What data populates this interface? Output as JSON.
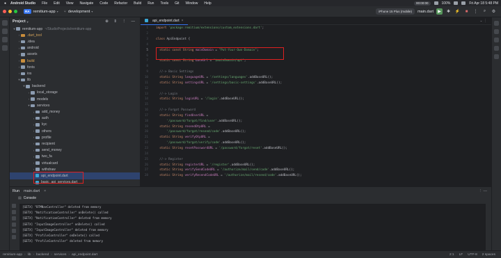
{
  "menubar": {
    "app_name": "Android Studio",
    "items": [
      "File",
      "Edit",
      "View",
      "Navigate",
      "Code",
      "Refactor",
      "Build",
      "Run",
      "Tools",
      "Git",
      "Window",
      "Help"
    ],
    "recording_time": "00:00:00",
    "battery": "100%",
    "datetime": "Fri Apr 18  5:48 PM"
  },
  "toolbar": {
    "project_badge": "RA",
    "project_name": "remitium-app",
    "branch": "development",
    "device": "iPhone 15 Plus (mobile)",
    "run_config": "main.dart"
  },
  "project_panel": {
    "title": "Project",
    "tree": [
      {
        "indent": 0,
        "arrow": "▾",
        "icon": "folder",
        "label": "remitium-app",
        "hint": "~/StudioProjects/remitium-app"
      },
      {
        "indent": 1,
        "arrow": "›",
        "icon": "folder-orange",
        "label": ".dart_tool",
        "orange": true
      },
      {
        "indent": 1,
        "arrow": "›",
        "icon": "folder",
        "label": ".idea"
      },
      {
        "indent": 1,
        "arrow": "›",
        "icon": "folder",
        "label": "android"
      },
      {
        "indent": 1,
        "arrow": "›",
        "icon": "folder",
        "label": "assets"
      },
      {
        "indent": 1,
        "arrow": "›",
        "icon": "folder-orange",
        "label": "build",
        "orange": true
      },
      {
        "indent": 1,
        "arrow": "›",
        "icon": "folder",
        "label": "fonts"
      },
      {
        "indent": 1,
        "arrow": "›",
        "icon": "folder",
        "label": "ios"
      },
      {
        "indent": 1,
        "arrow": "▾",
        "icon": "folder",
        "label": "lib"
      },
      {
        "indent": 2,
        "arrow": "▾",
        "icon": "folder",
        "label": "backend"
      },
      {
        "indent": 3,
        "arrow": "›",
        "icon": "folder",
        "label": "local_storage"
      },
      {
        "indent": 3,
        "arrow": "›",
        "icon": "folder",
        "label": "models"
      },
      {
        "indent": 3,
        "arrow": "▾",
        "icon": "folder",
        "label": "services"
      },
      {
        "indent": 4,
        "arrow": "›",
        "icon": "folder",
        "label": "add_money"
      },
      {
        "indent": 4,
        "arrow": "›",
        "icon": "folder",
        "label": "auth"
      },
      {
        "indent": 4,
        "arrow": "›",
        "icon": "folder",
        "label": "kyc"
      },
      {
        "indent": 4,
        "arrow": "›",
        "icon": "folder",
        "label": "others"
      },
      {
        "indent": 4,
        "arrow": "›",
        "icon": "folder",
        "label": "profile"
      },
      {
        "indent": 4,
        "arrow": "›",
        "icon": "folder",
        "label": "recipient"
      },
      {
        "indent": 4,
        "arrow": "›",
        "icon": "folder",
        "label": "send_money"
      },
      {
        "indent": 4,
        "arrow": "›",
        "icon": "folder",
        "label": "two_fa"
      },
      {
        "indent": 4,
        "arrow": "›",
        "icon": "folder",
        "label": "virtualcard"
      },
      {
        "indent": 4,
        "arrow": "›",
        "icon": "folder",
        "label": "withdraw"
      },
      {
        "indent": 4,
        "arrow": "",
        "icon": "dart",
        "label": "api_endpoint.dart",
        "selected": true
      },
      {
        "indent": 4,
        "arrow": "",
        "icon": "dart",
        "label": "basic_api_services.dart"
      }
    ]
  },
  "editor": {
    "tab_label": "api_endpoint.dart",
    "lines": [
      {
        "n": "1",
        "text": "import 'package:remitium/extensions/custom_extensions.dart';"
      },
      {
        "n": "2",
        "text": ""
      },
      {
        "n": "3",
        "text": "class ApiEndpoint {"
      },
      {
        "n": "4",
        "text": ""
      },
      {
        "n": "5",
        "text": "  static const String mainDomain = \"Put-Your-Own-Domain\";"
      },
      {
        "n": "6",
        "text": ""
      },
      {
        "n": "7",
        "text": "  static const String baseUrl = \"$mainDomain/api\";"
      },
      {
        "n": "8",
        "text": ""
      },
      {
        "n": "9",
        "text": "  //-> Basic Settings"
      },
      {
        "n": "10",
        "text": "  static String languageURL = '/settings/languages'.addBaseURL();"
      },
      {
        "n": "11",
        "text": "  static String settingsURL = '/settings/basic-settings'.addBaseURL();"
      },
      {
        "n": "12",
        "text": ""
      },
      {
        "n": "13",
        "text": "  //-> Login"
      },
      {
        "n": "14",
        "text": "  static String loginURL = '/login'.addBaseURL();"
      },
      {
        "n": "15",
        "text": ""
      },
      {
        "n": "16",
        "text": "  //-> Forgot Password"
      },
      {
        "n": "17",
        "text": "  static String findUserURL ="
      },
      {
        "n": "18",
        "text": "      '/password/forgot/find/user'.addBaseURL();"
      },
      {
        "n": "19",
        "text": "  static String resendOtpURL ="
      },
      {
        "n": "20",
        "text": "      '/password/forgot/resend/code'.addBaseURL();"
      },
      {
        "n": "21",
        "text": "  static String verifyOtpURL ="
      },
      {
        "n": "22",
        "text": "      '/password/forgot/verify/code'.addBaseURL();"
      },
      {
        "n": "23",
        "text": "  static String resetPasswordURL = '/password/forgot/reset'.addBaseURL();"
      },
      {
        "n": "24",
        "text": ""
      },
      {
        "n": "25",
        "text": "  //-> Register"
      },
      {
        "n": "26",
        "text": "  static String registerURL = '/register'.addBaseURL();"
      },
      {
        "n": "27",
        "text": "  static String verifySendCodeURL = '/authorize/mail/send/code'.addBaseURL();"
      },
      {
        "n": "28",
        "text": "  static String verifyResendCodeURL = '/authorize/mail/resend/code'.addBaseURL();"
      }
    ]
  },
  "run_panel": {
    "title": "Run",
    "tab": "main.dart",
    "console_label": "Console",
    "logs": [
      "[GETX] \"BTMNavController\" deleted from memory",
      "[GETX] \"NotificationController\" onDelete() called",
      "[GETX] \"NotificationController\" deleted from memory",
      "[GETX] \"InputImageController\" onDelete() called",
      "[GETX] \"InputImageController\" deleted from memory",
      "[GETX] \"ProfileController\" onDelete() called",
      "[GETX] \"ProfileController\" deleted from memory"
    ]
  },
  "statusbar": {
    "breadcrumb": [
      "remitium-app",
      "lib",
      "backend",
      "services",
      "api_endpoint.dart"
    ],
    "position": "2:1",
    "line_sep": "LF",
    "encoding": "UTF-8",
    "indent": "2 spaces"
  },
  "colors": {
    "accent": "#3574f0",
    "highlight_box": "#e02020",
    "keyword": "#cf8e6d",
    "string": "#6aab73",
    "comment": "#7a7e85",
    "field": "#c77dbb"
  }
}
